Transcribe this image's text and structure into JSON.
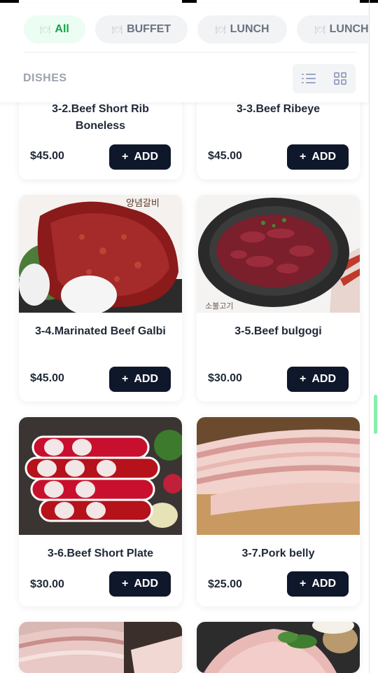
{
  "tabs": [
    {
      "label": "All",
      "active": true
    },
    {
      "label": "BUFFET",
      "active": false
    },
    {
      "label": "LUNCH",
      "active": false
    },
    {
      "label": "LUNCH",
      "active": false
    }
  ],
  "tab_icon": "utensils-icon",
  "section_title": "DISHES",
  "view_modes": [
    "list-view-icon",
    "grid-view-icon"
  ],
  "add_label": "ADD",
  "add_icon": "+",
  "dishes": [
    {
      "name": "3-2.Beef Short Rib Boneless",
      "price": "$45.00"
    },
    {
      "name": "3-3.Beef Ribeye",
      "price": "$45.00"
    },
    {
      "name": "3-4.Marinated Beef Galbi",
      "price": "$45.00",
      "image_text": "양념갈비"
    },
    {
      "name": "3-5.Beef bulgogi",
      "price": "$30.00",
      "image_text": "소불고기"
    },
    {
      "name": "3-6.Beef Short Plate",
      "price": "$30.00"
    },
    {
      "name": "3-7.Pork belly",
      "price": "$25.00"
    },
    {
      "name": "",
      "price": ""
    },
    {
      "name": "",
      "price": ""
    }
  ],
  "colors": {
    "accent_green": "#16a34a",
    "add_button": "#0f172a",
    "muted_text": "#9ca3af"
  }
}
